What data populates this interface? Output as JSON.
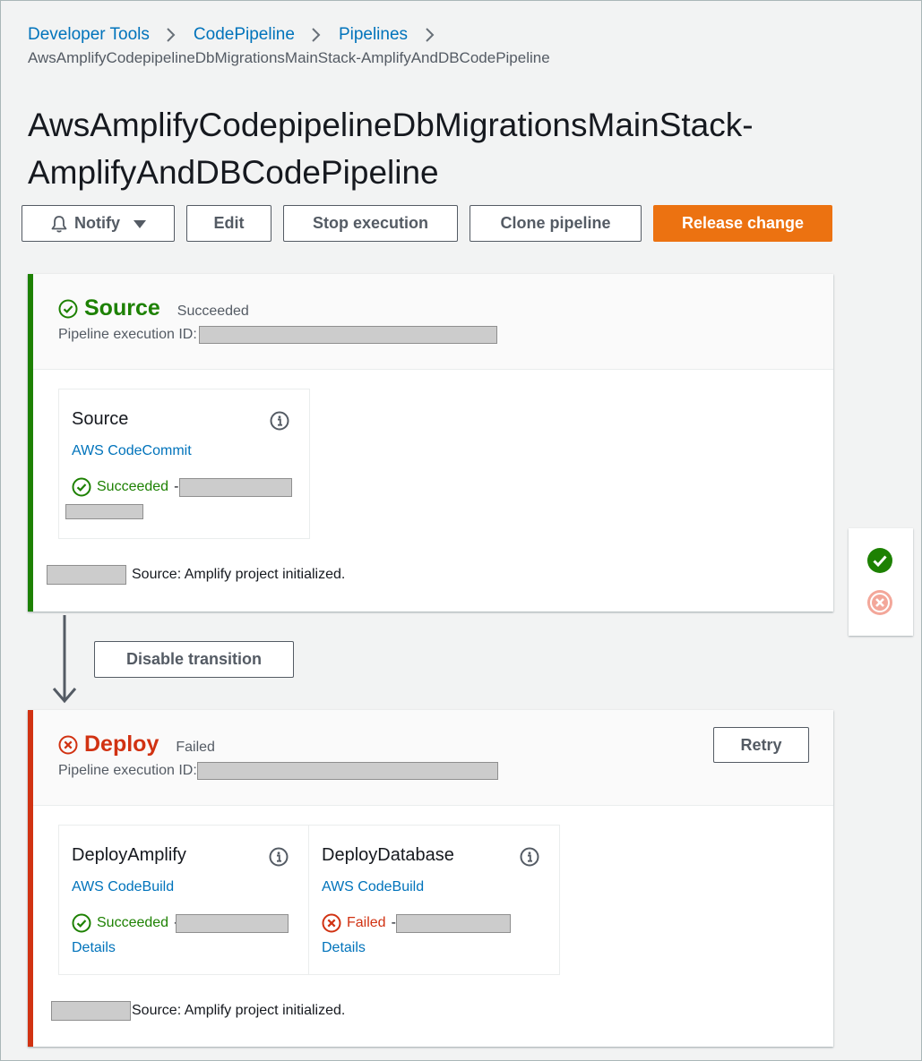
{
  "breadcrumb": {
    "items": [
      "Developer Tools",
      "CodePipeline",
      "Pipelines"
    ],
    "current": "AwsAmplifyCodepipelineDbMigrationsMainStack-AmplifyAndDBCodePipeline"
  },
  "page": {
    "title_line1": "AwsAmplifyCodepipelineDbMigrationsMainStack-",
    "title_line2": "AmplifyAndDBCodePipeline"
  },
  "toolbar": {
    "notify": "Notify",
    "edit": "Edit",
    "stop": "Stop execution",
    "clone": "Clone pipeline",
    "release": "Release change"
  },
  "colors": {
    "success": "#1d8102",
    "failure": "#d13212",
    "primary": "#ec7211",
    "link": "#0073bb"
  },
  "stages": {
    "source": {
      "name": "Source",
      "status": "Succeeded",
      "exec_label": "Pipeline execution ID:",
      "actions": [
        {
          "name": "Source",
          "provider": "AWS CodeCommit",
          "status": "Succeeded",
          "status_sep": "-"
        }
      ],
      "commit_message": "Source: Amplify project initialized."
    },
    "deploy": {
      "name": "Deploy",
      "status": "Failed",
      "exec_label": "Pipeline execution ID:",
      "retry": "Retry",
      "actions": [
        {
          "name": "DeployAmplify",
          "provider": "AWS CodeBuild",
          "status": "Succeeded",
          "status_sep": "-",
          "details": "Details"
        },
        {
          "name": "DeployDatabase",
          "provider": "AWS CodeBuild",
          "status": "Failed",
          "status_sep": "-",
          "details": "Details"
        }
      ],
      "commit_message": "Source: Amplify project initialized."
    }
  },
  "transition": {
    "disable_label": "Disable transition"
  },
  "icons": {
    "notify": "bell-icon",
    "caret": "caret-down-icon",
    "success": "check-circle-icon",
    "failure": "x-circle-icon",
    "info": "info-icon",
    "arrow": "arrow-down-icon"
  }
}
